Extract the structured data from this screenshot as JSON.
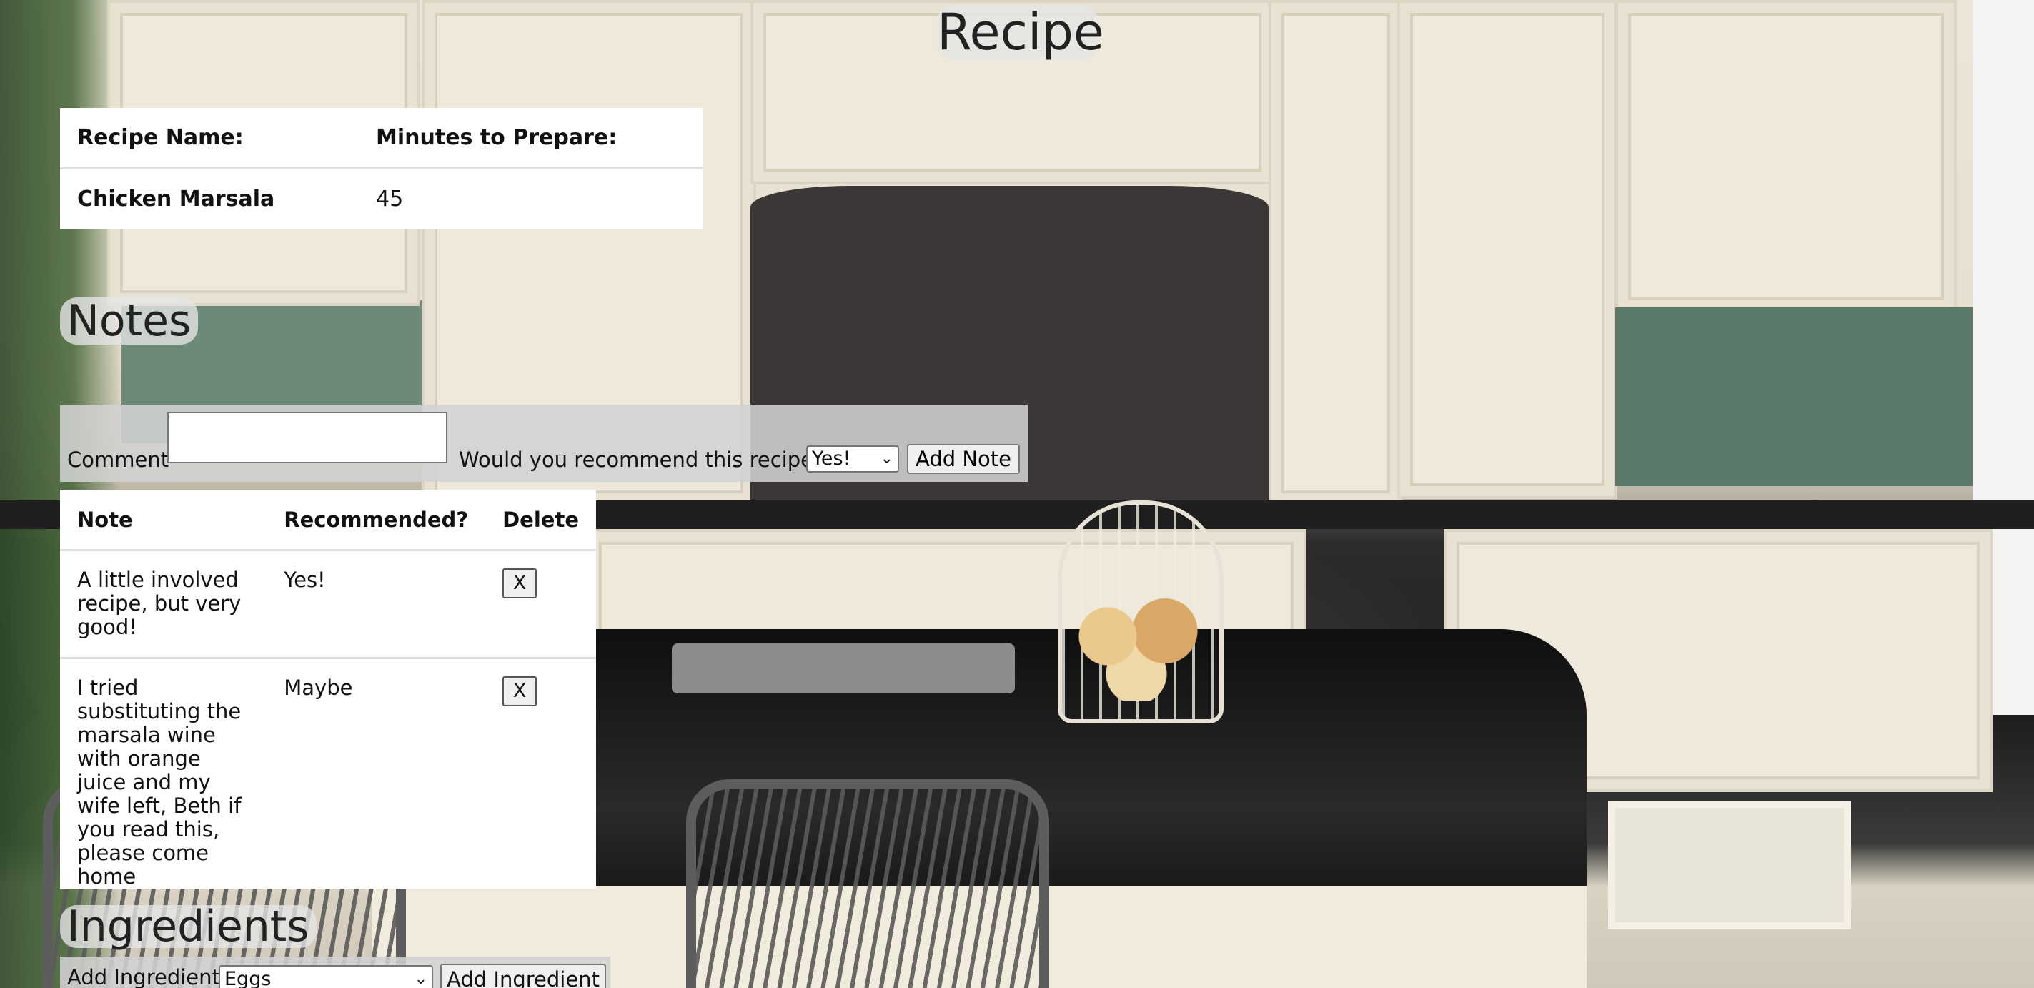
{
  "page": {
    "title": "Recipe"
  },
  "recipe": {
    "headers": [
      "Recipe Name:",
      "Minutes to Prepare:"
    ],
    "name": "Chicken Marsala",
    "minutes": "45"
  },
  "notes": {
    "heading": "Notes",
    "form": {
      "comment_label": "Comment",
      "comment_value": "",
      "recommend_label": "Would you recommend this recipe?",
      "recommend_selected": "Yes!",
      "add_button": "Add Note"
    },
    "table": {
      "headers": [
        "Note",
        "Recommended?",
        "Delete"
      ],
      "rows": [
        {
          "note": "A little involved recipe, but very good!",
          "recommended": "Yes!",
          "delete_label": "X"
        },
        {
          "note": "I tried substituting the marsala wine with orange juice and my wife left, Beth if you read this, please come home",
          "recommended": "Maybe",
          "delete_label": "X"
        }
      ]
    }
  },
  "ingredients": {
    "heading": "Ingredients",
    "form": {
      "add_label": "Add Ingredient",
      "selected": "Eggs",
      "add_button": "Add Ingredient"
    }
  },
  "icons": {
    "dropdown": "chevron-down-icon",
    "resize": "resize-handle-icon"
  }
}
